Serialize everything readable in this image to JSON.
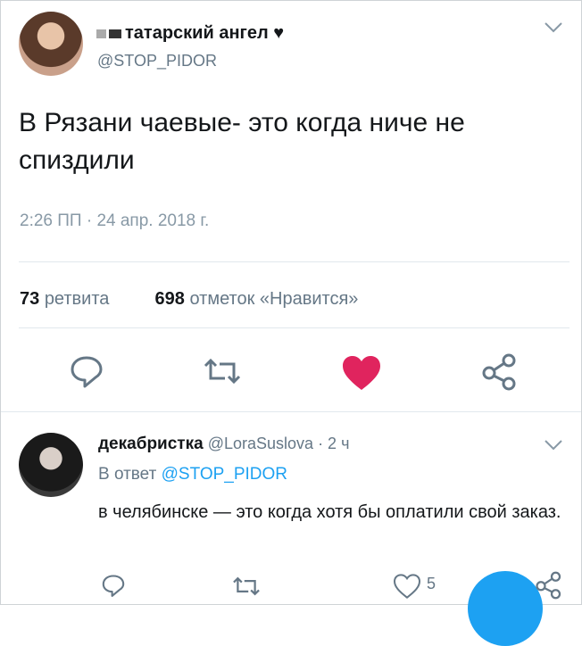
{
  "tweet": {
    "author": {
      "name": "татарский ангел",
      "handle": "@STOP_PIDOR"
    },
    "text": "В Рязани чаевые- это когда ниче не спиздили",
    "timestamp": "2:26 ПП · 24 апр. 2018 г.",
    "stats": {
      "retweets_count": "73",
      "retweets_label": "ретвита",
      "likes_count": "698",
      "likes_label": "отметок «Нравится»"
    }
  },
  "reply": {
    "author": {
      "name": "декабристка",
      "handle": "@LoraSuslova"
    },
    "age": "· 2 ч",
    "reply_prefix": "В ответ",
    "reply_handle": "@STOP_PIDOR",
    "text": "в челябинске — это когда хотя бы оплатили свой заказ.",
    "like_count": "5"
  },
  "colors": {
    "accent": "#1da1f2",
    "like_active": "#e0245e",
    "muted": "#657786"
  },
  "icons": [
    "reply-icon",
    "retweet-icon",
    "like-icon",
    "share-icon",
    "chevron-down-icon",
    "heart-icon"
  ]
}
